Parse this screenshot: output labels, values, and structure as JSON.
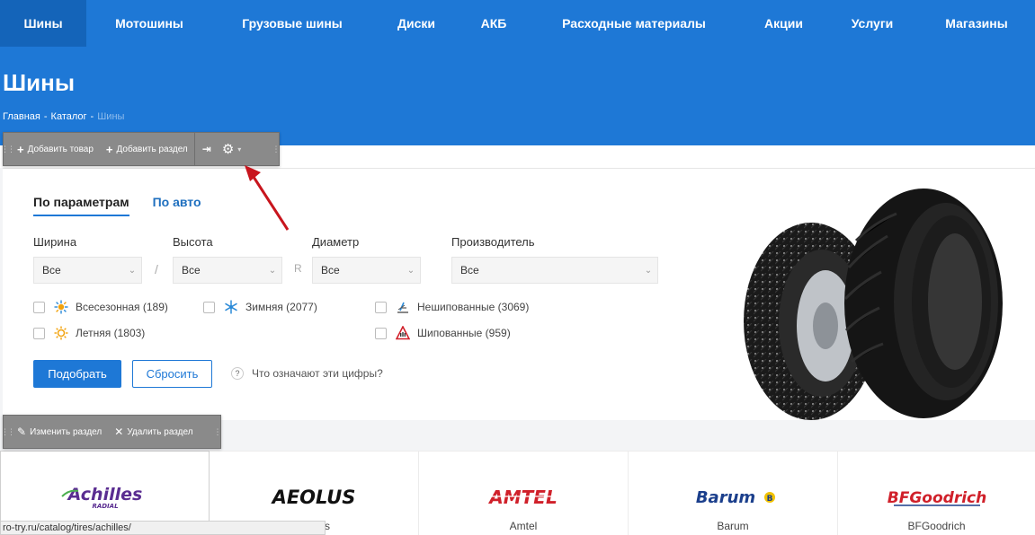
{
  "nav": {
    "items": [
      {
        "label": "Шины"
      },
      {
        "label": "Мотошины"
      },
      {
        "label": "Грузовые шины"
      },
      {
        "label": "Диски"
      },
      {
        "label": "АКБ"
      },
      {
        "label": "Расходные материалы"
      },
      {
        "label": "Акции"
      },
      {
        "label": "Услуги"
      },
      {
        "label": "Магазины"
      }
    ],
    "active_index": 0
  },
  "page": {
    "title": "Шины",
    "breadcrumb": [
      "Главная",
      "Каталог",
      "Шины"
    ],
    "breadcrumb_separator": "-"
  },
  "admin_toolbar": {
    "add_product": "Добавить товар",
    "add_section": "Добавить раздел"
  },
  "section_toolbar": {
    "edit_section": "Изменить раздел",
    "delete_section": "Удалить раздел"
  },
  "filter": {
    "tabs": [
      "По параметрам",
      "По авто"
    ],
    "active_tab": 0,
    "fields": [
      {
        "label": "Ширина",
        "value": "Все"
      },
      {
        "label": "Высота",
        "value": "Все"
      },
      {
        "label": "Диаметр",
        "value": "Все"
      },
      {
        "label": "Производитель",
        "value": "Все"
      }
    ],
    "separators": [
      "/",
      "R"
    ],
    "seasons": [
      {
        "label": "Всесезонная (189)",
        "icon": "all-season-icon"
      },
      {
        "label": "Летняя (1803)",
        "icon": "sun-icon"
      },
      {
        "label": "Зимняя (2077)",
        "icon": "snowflake-icon"
      },
      {
        "label": "Нешипованные (3069)",
        "icon": "studless-icon"
      },
      {
        "label": "Шипованные (959)",
        "icon": "studded-icon"
      }
    ],
    "submit_label": "Подобрать",
    "reset_label": "Сбросить",
    "help_label": "Что означают эти цифры?",
    "help_icon": "?"
  },
  "brands": [
    {
      "logo": "Achilles",
      "sub": "RADIAL",
      "name": "",
      "color": "#5a2d91"
    },
    {
      "logo": "AEOLUS",
      "name": "s",
      "color": "#111111"
    },
    {
      "logo": "AMTEL",
      "name": "Amtel",
      "color": "#d0202a"
    },
    {
      "logo": "Barum",
      "name": "Barum",
      "color": "#1b3f8c"
    },
    {
      "logo": "BFGoodrich",
      "name": "BFGoodrich",
      "color": "#d0202a"
    }
  ],
  "status_url": "ro-try.ru/catalog/tires/achilles/",
  "colors": {
    "brand_blue": "#1e78d6",
    "nav_active": "#1464b9"
  }
}
